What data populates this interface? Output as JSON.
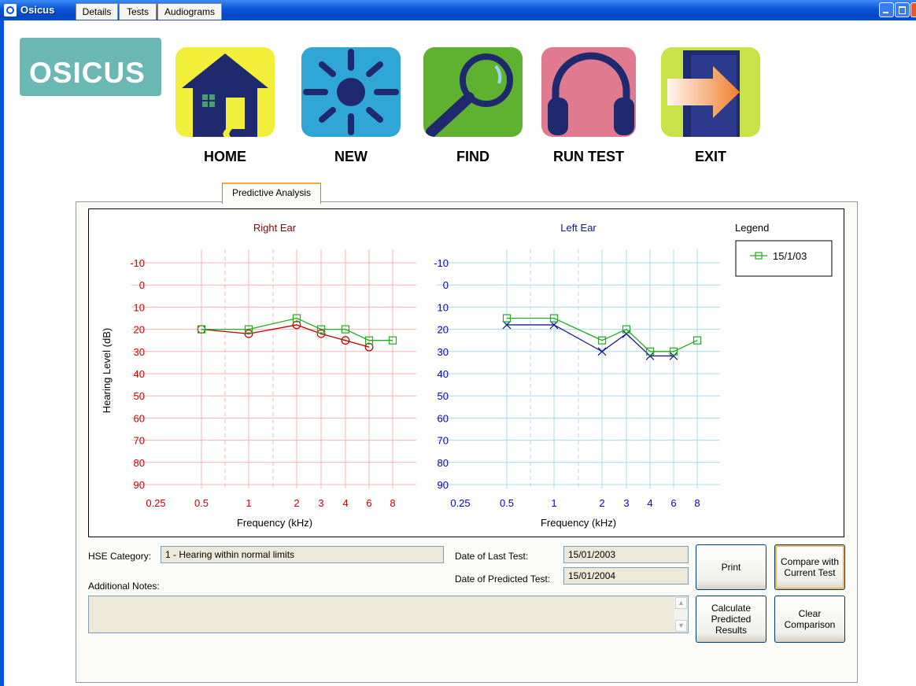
{
  "window": {
    "title": "Osicus"
  },
  "logo": {
    "text": "OSICUS"
  },
  "nav": {
    "home": "HOME",
    "new": "NEW",
    "find": "FIND",
    "run_test": "RUN TEST",
    "exit": "EXIT"
  },
  "tabs": [
    "Details",
    "Tests",
    "Audiograms",
    "Predictive Analysis"
  ],
  "active_tab": "Predictive Analysis",
  "chart_data": {
    "type": "line",
    "ylabel": "Hearing Level (dB)",
    "xlabel": "Frequency (kHz)",
    "y_ticks": [
      -10,
      0,
      10,
      20,
      30,
      40,
      50,
      60,
      70,
      80,
      90
    ],
    "x_ticks": [
      "0.25",
      "0.5",
      "1",
      "2",
      "3",
      "4",
      "6",
      "8"
    ],
    "x_values": [
      0.25,
      0.5,
      1,
      2,
      3,
      4,
      6,
      8
    ],
    "ylim": [
      -15,
      95
    ],
    "legend": {
      "title": "Legend",
      "entries": [
        "15/1/03"
      ],
      "position": "right"
    },
    "colors": {
      "right": "#cc0000",
      "left": "#0000cc",
      "predicted": "#22aa22",
      "right_grid": "#f5b3b3",
      "left_grid": "#a8d8ea"
    },
    "panels": [
      {
        "title": "Right Ear",
        "series": [
          {
            "name": "15/1/03",
            "marker": "square",
            "points": [
              [
                0.5,
                20
              ],
              [
                1,
                20
              ],
              [
                2,
                15
              ],
              [
                3,
                20
              ],
              [
                4,
                20
              ],
              [
                6,
                25
              ],
              [
                8,
                25
              ]
            ]
          },
          {
            "marker": "circle",
            "points": [
              [
                0.5,
                20
              ],
              [
                1,
                22
              ],
              [
                2,
                18
              ],
              [
                3,
                22
              ],
              [
                4,
                25
              ],
              [
                6,
                28
              ]
            ]
          }
        ]
      },
      {
        "title": "Left Ear",
        "series": [
          {
            "name": "15/1/03",
            "marker": "square",
            "points": [
              [
                0.5,
                15
              ],
              [
                1,
                15
              ],
              [
                2,
                25
              ],
              [
                3,
                20
              ],
              [
                4,
                30
              ],
              [
                6,
                30
              ],
              [
                8,
                25
              ]
            ]
          },
          {
            "marker": "cross",
            "points": [
              [
                0.5,
                18
              ],
              [
                1,
                18
              ],
              [
                2,
                30
              ],
              [
                3,
                22
              ],
              [
                4,
                32
              ],
              [
                6,
                32
              ]
            ]
          }
        ]
      }
    ]
  },
  "form": {
    "hse_label": "HSE Category:",
    "hse_value": "1 - Hearing within  normal limits",
    "notes_label": "Additional Notes:",
    "notes_value": "",
    "last_test_label": "Date of Last Test:",
    "last_test_value": "15/01/2003",
    "predicted_label": "Date of Predicted Test:",
    "predicted_value": "15/01/2004"
  },
  "buttons": {
    "print": "Print",
    "compare": "Compare with Current Test",
    "calculate": "Calculate Predicted Results",
    "clear": "Clear Comparison"
  }
}
